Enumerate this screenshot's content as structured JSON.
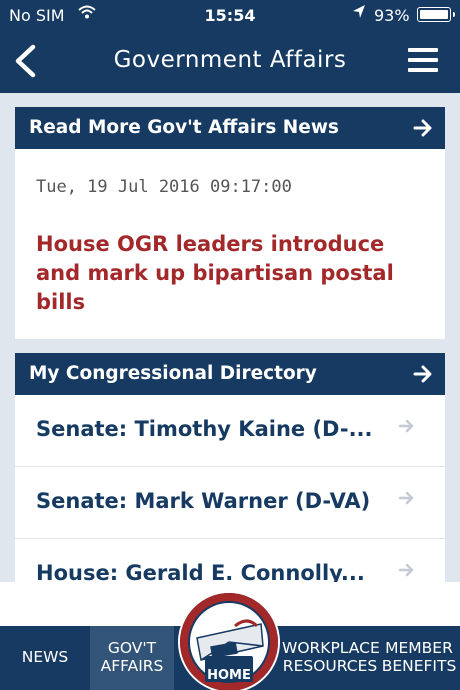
{
  "status": {
    "carrier": "No SIM",
    "time": "15:54",
    "battery_pct": "93%",
    "battery_level": 0.93
  },
  "nav": {
    "title": "Government Affairs",
    "back_glyph": "‹",
    "menu_icon": "hamburger-menu-icon"
  },
  "news_card": {
    "header": "Read More Gov't Affairs News",
    "date": "Tue, 19 Jul 2016 09:17:00",
    "headline": "House OGR leaders introduce and mark up bipartisan postal bills"
  },
  "directory": {
    "header": "My Congressional Directory",
    "items": [
      {
        "name": "Senate: Timothy Kaine (D-..."
      },
      {
        "name": "Senate: Mark Warner (D-VA)"
      },
      {
        "name": "House: Gerald E. Connolly..."
      }
    ]
  },
  "tabs": {
    "news": "NEWS",
    "gov_line1": "GOV'T",
    "gov_line2": "AFFAIRS",
    "home": "HOME",
    "workplace_line1": "WORKPLACE",
    "workplace_line2": "RESOURCES",
    "member_line1": "MEMBER",
    "member_line2": "BENEFITS"
  },
  "colors": {
    "navy": "#163a61",
    "headline_red": "#a3282a",
    "active_tab": "#325478"
  }
}
